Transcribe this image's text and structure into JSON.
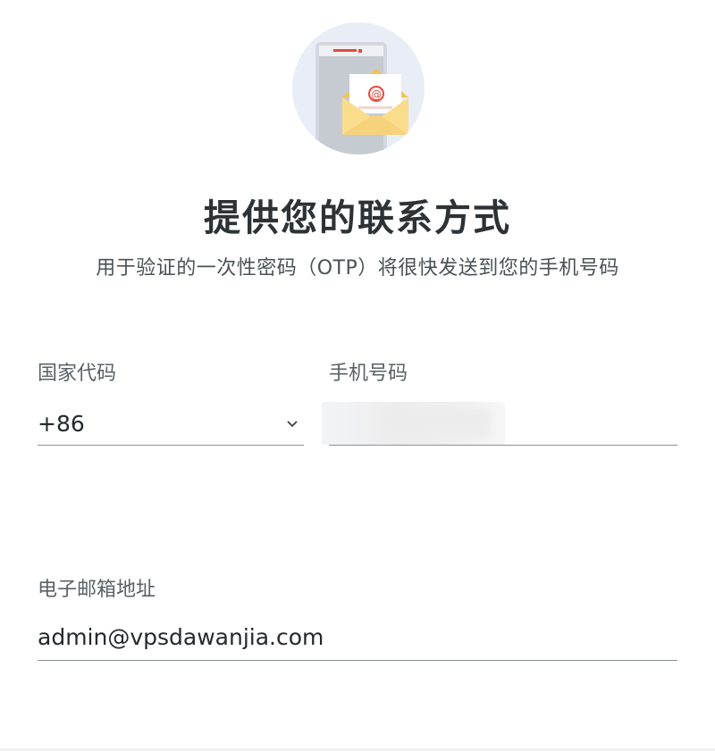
{
  "page": {
    "title": "提供您的联系方式",
    "subtitle": "用于验证的一次性密码（OTP）将很快发送到您的手机号码"
  },
  "illustration": {
    "icon": "phone-envelope-illustration",
    "at_symbol": "@"
  },
  "form": {
    "country_code": {
      "label": "国家代码",
      "value": "+86"
    },
    "phone_number": {
      "label": "手机号码",
      "value": ""
    },
    "email": {
      "label": "电子邮箱地址",
      "value": "admin@vpsdawanjia.com"
    }
  },
  "colors": {
    "accent": "#e5493a",
    "envelope": "#f6d27a",
    "circle": "#e8edf6"
  }
}
